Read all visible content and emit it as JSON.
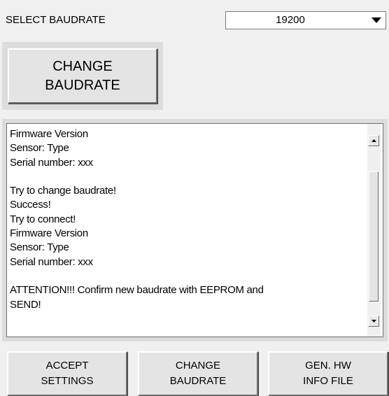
{
  "baudrate": {
    "label": "SELECT BAUDRATE",
    "selected": "19200"
  },
  "change_baudrate_top": "CHANGE\nBAUDRATE",
  "log": {
    "lines": [
      "Firmware Version",
      "Sensor: Type",
      "Serial number: xxx",
      "",
      "Try to change baudrate!",
      "Success!",
      "Try to connect!",
      "Firmware Version",
      "Sensor: Type",
      "Serial number: xxx",
      "",
      "ATTENTION!!!   Confirm new baudrate with EEPROM and",
      "SEND!"
    ]
  },
  "buttons": {
    "accept_settings": "ACCEPT\nSETTINGS",
    "change_baudrate": "CHANGE\nBAUDRATE",
    "gen_hw_info": "GEN. HW\nINFO FILE"
  },
  "icons": {
    "dropdown": "chevron-down-icon",
    "scroll_up": "scroll-up-icon",
    "scroll_down": "scroll-down-icon"
  }
}
